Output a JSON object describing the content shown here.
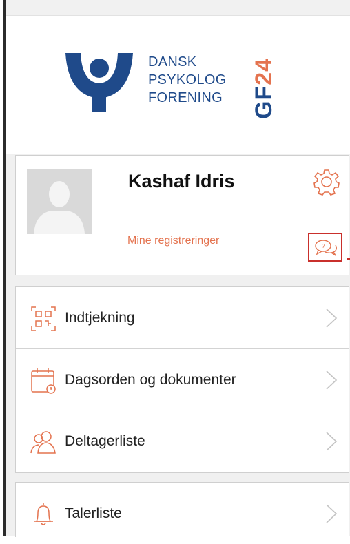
{
  "logo": {
    "line1": "DANSK",
    "line2": "PSYKOLOG",
    "line3": "FORENING",
    "badge_prefix": "GF",
    "badge_number": "24"
  },
  "profile": {
    "name": "Kashaf Idris",
    "registrations_link": "Mine registreringer",
    "settings_icon": "gear-icon",
    "chat_icon": "chat-bubbles-icon"
  },
  "menu": [
    {
      "label": "Indtjekning",
      "icon": "qr-code-icon"
    },
    {
      "label": "Dagsorden og dokumenter",
      "icon": "calendar-icon"
    },
    {
      "label": "Deltagerliste",
      "icon": "participants-icon"
    }
  ],
  "menu2": [
    {
      "label": "Talerliste",
      "icon": "bell-icon"
    }
  ],
  "colors": {
    "brand_blue": "#1f4a8a",
    "accent": "#e4734f",
    "highlight_border": "#c9302c"
  }
}
